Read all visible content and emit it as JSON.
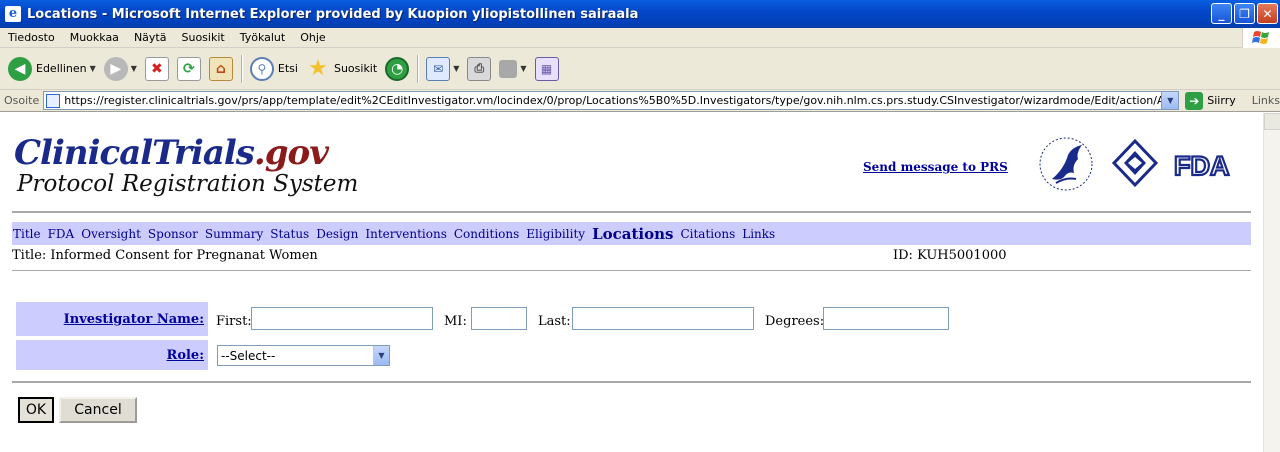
{
  "window": {
    "title": "Locations - Microsoft Internet Explorer provided by Kuopion yliopistollinen sairaala",
    "minimize": "_",
    "maximize": "❐",
    "close": "✕"
  },
  "menu": [
    "Tiedosto",
    "Muokkaa",
    "Näytä",
    "Suosikit",
    "Työkalut",
    "Ohje"
  ],
  "toolbar": {
    "back_label": "Edellinen",
    "search_label": "Etsi",
    "favorites_label": "Suosikit"
  },
  "address": {
    "label": "Osoite",
    "url": "https://register.clinicaltrials.gov/prs/app/template/edit%2CEditInvestigator.vm/locindex/0/prop/Locations%5B0%5D.Investigators/type/gov.nih.nlm.cs.prs.study.CSInvestigator/wizardmode/Edit/action/AddInvestigator/ts/79/uid",
    "go_label": "Siirry",
    "links_label": "Links"
  },
  "header": {
    "logo_main": "ClinicalTrials",
    "logo_gov": ".gov",
    "logo_sub": "Protocol Registration System",
    "send_message": "Send message to PRS",
    "agency_fda": "FDA"
  },
  "nav": [
    "Title",
    "FDA",
    "Oversight",
    "Sponsor",
    "Summary",
    "Status",
    "Design",
    "Interventions",
    "Conditions",
    "Eligibility",
    "Locations",
    "Citations",
    "Links"
  ],
  "nav_current": "Locations",
  "study": {
    "title": "Title: Informed Consent for Pregnanat Women",
    "id": "ID: KUH5001000"
  },
  "form": {
    "investigator_label": "Investigator Name:",
    "first_label": "First:",
    "first_value": "",
    "mi_label": "MI:",
    "mi_value": "",
    "last_label": "Last:",
    "last_value": "",
    "degrees_label": "Degrees:",
    "degrees_value": "",
    "role_label": "Role:",
    "role_value": "--Select--"
  },
  "buttons": {
    "ok": "OK",
    "cancel": "Cancel"
  }
}
